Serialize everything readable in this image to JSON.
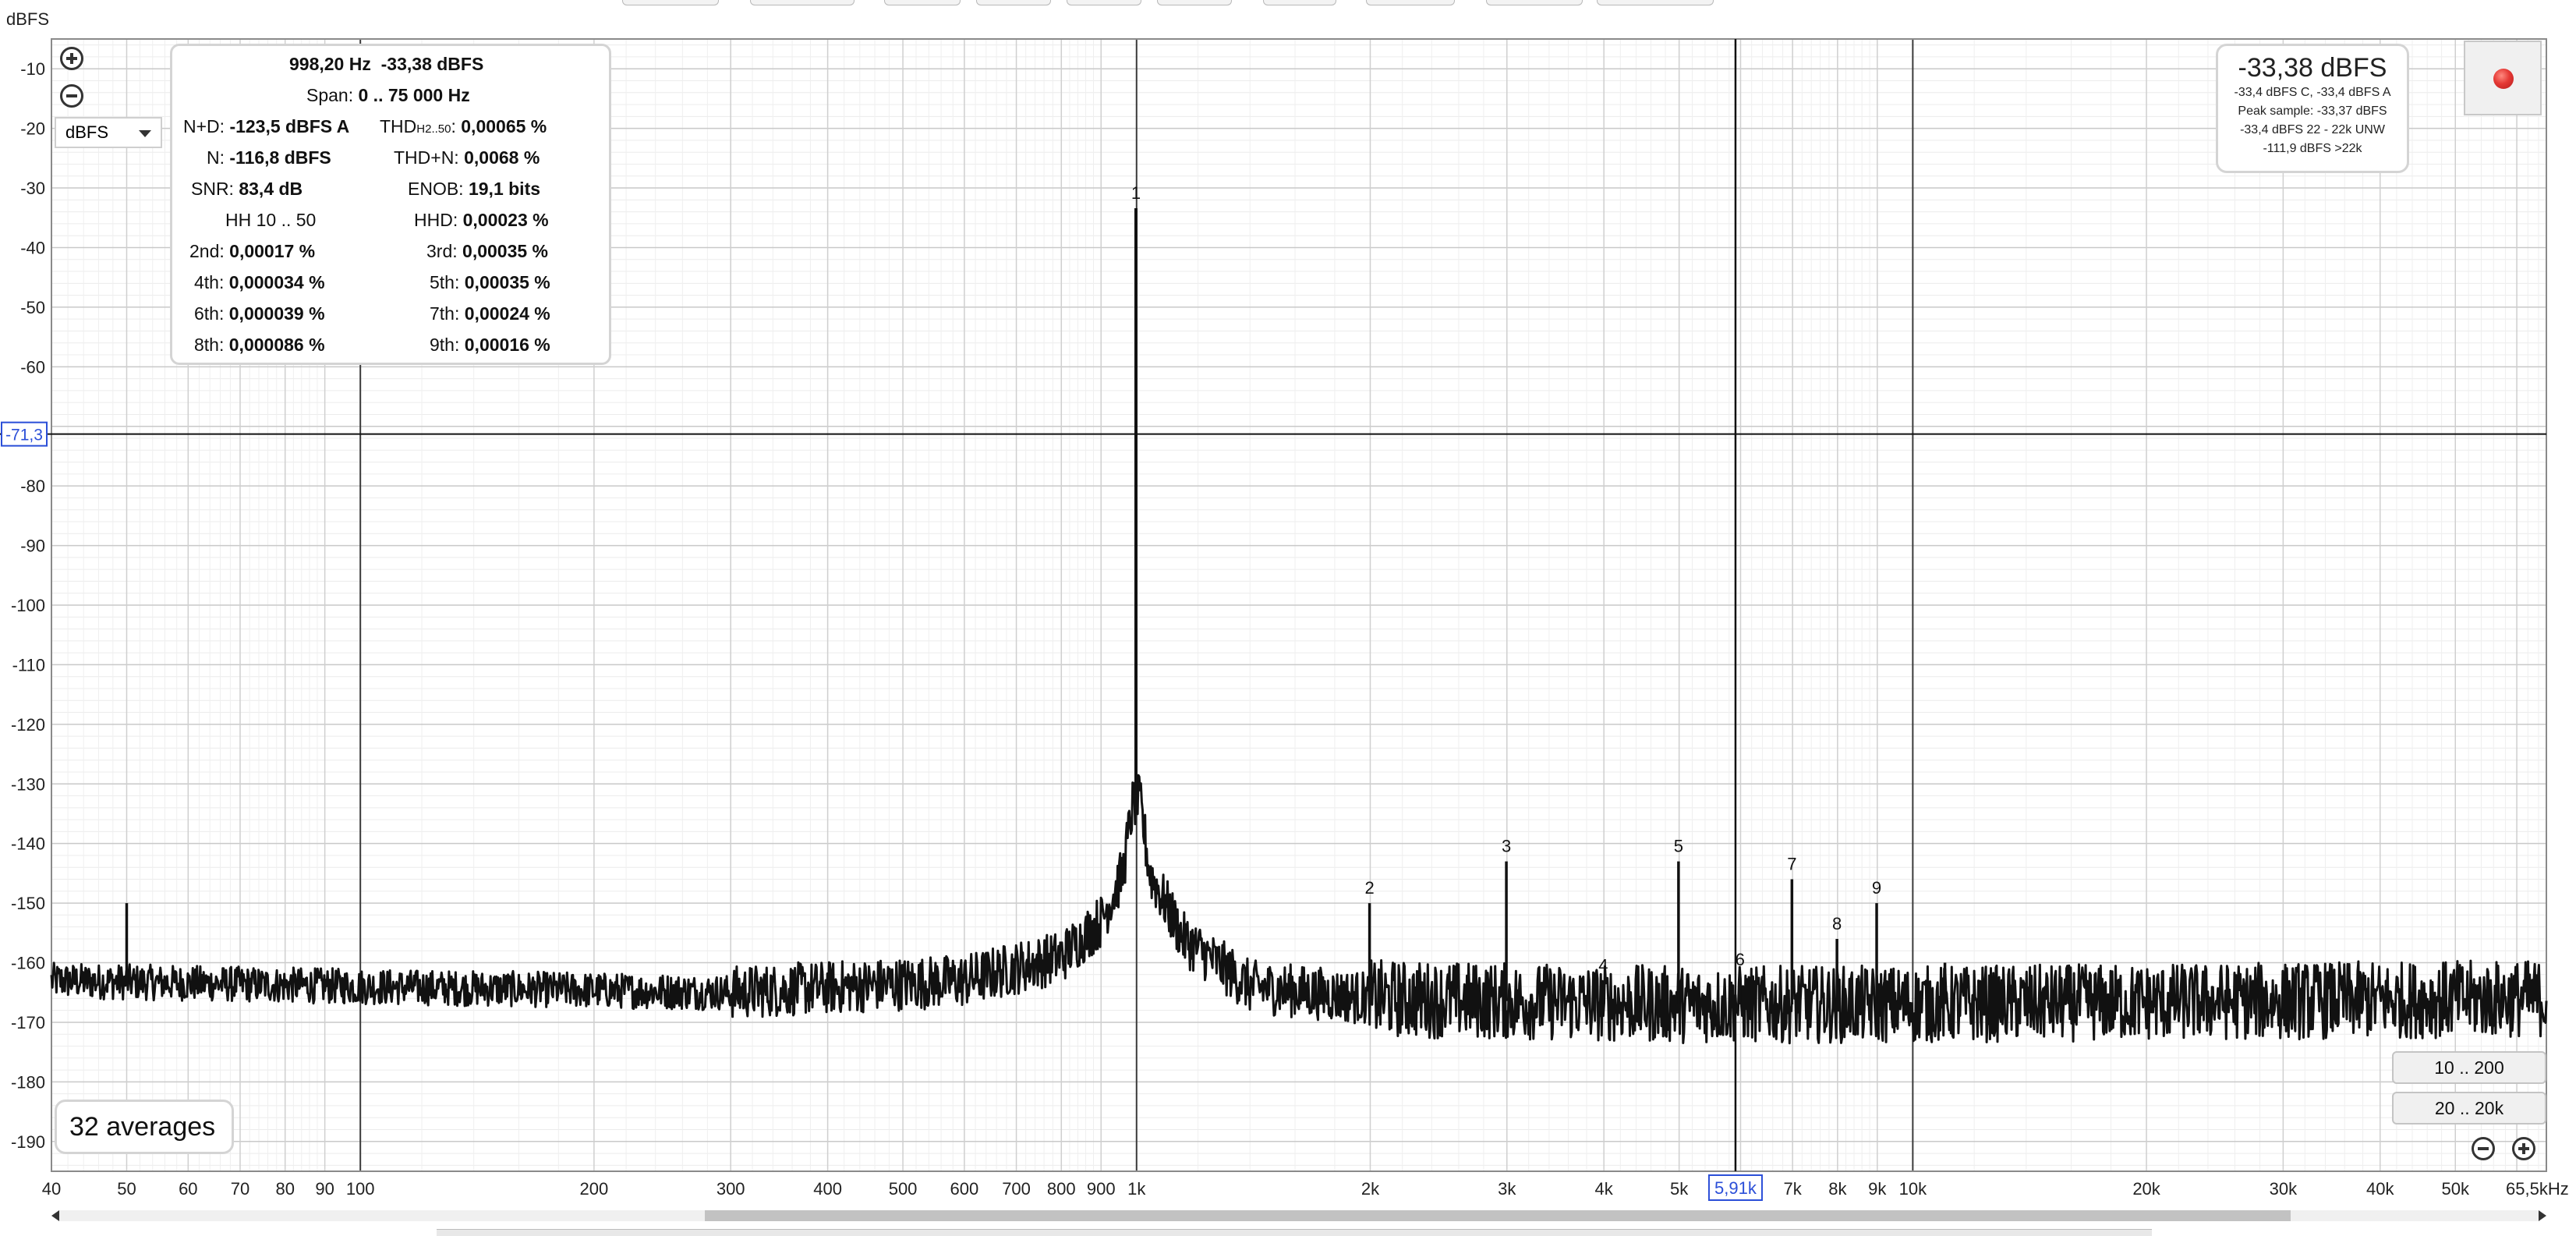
{
  "toolbar": {
    "tabs": 11
  },
  "axis": {
    "y_unit": "dBFS",
    "x_unit_suffix": "65,5kHz"
  },
  "unit_select": {
    "value": "dBFS"
  },
  "cursor": {
    "y_readout": "-71,3",
    "x_readout": "5,91k"
  },
  "info_panel": {
    "freq": "998,20 Hz",
    "level": "-33,38 dBFS",
    "span_label": "Span:",
    "span_value": "0 .. 75 000 Hz",
    "nd_label": "N+D:",
    "nd_value": "-123,5 dBFS A",
    "thd_label_main": "THD",
    "thd_label_sub": "H2..50",
    "thd_value": "0,00065 %",
    "n_label": "N:",
    "n_value": "-116,8 dBFS",
    "thdn_label": "THD+N:",
    "thdn_value": "0,0068 %",
    "snr_label": "SNR:",
    "snr_value": "83,4 dB",
    "enob_label": "ENOB:",
    "enob_value": "19,1 bits",
    "hh_label": "HH 10 .. 50",
    "hhd_label": "HHD:",
    "hhd_value": "0,00023 %",
    "h2_label": "2nd:",
    "h2_value": "0,00017 %",
    "h3_label": "3rd:",
    "h3_value": "0,00035 %",
    "h4_label": "4th:",
    "h4_value": "0,000034 %",
    "h5_label": "5th:",
    "h5_value": "0,00035 %",
    "h6_label": "6th:",
    "h6_value": "0,000039 %",
    "h7_label": "7th:",
    "h7_value": "0,00024 %",
    "h8_label": "8th:",
    "h8_value": "0,000086 %",
    "h9_label": "9th:",
    "h9_value": "0,00016 %"
  },
  "level_box": {
    "main": "-33,38 dBFS",
    "line1": "-33,4 dBFS C, -33,4 dBFS A",
    "line2": "Peak sample: -33,37 dBFS",
    "line3": "-33,4 dBFS 22 - 22k UNW",
    "line4": "-111,9 dBFS >22k"
  },
  "averages": "32 averages",
  "range_buttons": {
    "a": "10 .. 200",
    "b": "20 .. 20k"
  },
  "chart_data": {
    "type": "line",
    "xscale": "log",
    "xlim": [
      40,
      65500
    ],
    "ylim": [
      -195,
      -5
    ],
    "ylabel": "dBFS",
    "y_ticks": [
      -10,
      -20,
      -30,
      -40,
      -50,
      -60,
      -80,
      -90,
      -100,
      -110,
      -120,
      -130,
      -140,
      -150,
      -160,
      -170,
      -180,
      -190
    ],
    "y_tick_labels": [
      "-10",
      "-20",
      "-30",
      "-40",
      "-50",
      "-60",
      "-80",
      "-90",
      "-100",
      "-110",
      "-120",
      "-130",
      "-140",
      "-150",
      "-160",
      "-170",
      "-180",
      "-190"
    ],
    "x_ticks": [
      40,
      50,
      60,
      70,
      80,
      90,
      100,
      200,
      300,
      400,
      500,
      600,
      700,
      800,
      900,
      1000,
      2000,
      3000,
      4000,
      5000,
      7000,
      8000,
      9000,
      10000,
      20000,
      30000,
      40000,
      50000
    ],
    "x_tick_labels": [
      "40",
      "50",
      "60",
      "70",
      "80",
      "90",
      "100",
      "200",
      "300",
      "400",
      "500",
      "600",
      "700",
      "800",
      "900",
      "1k",
      "2k",
      "3k",
      "4k",
      "5k",
      "7k",
      "8k",
      "9k",
      "10k",
      "20k",
      "30k",
      "40k",
      "50k"
    ],
    "grid": true,
    "noise_floor": [
      [
        40,
        -163
      ],
      [
        100,
        -164
      ],
      [
        300,
        -165
      ],
      [
        600,
        -163
      ],
      [
        800,
        -159
      ],
      [
        900,
        -153
      ],
      [
        960,
        -145
      ],
      [
        990,
        -133
      ],
      [
        1010,
        -133
      ],
      [
        1040,
        -145
      ],
      [
        1150,
        -156
      ],
      [
        1400,
        -164
      ],
      [
        2000,
        -166
      ],
      [
        5000,
        -167
      ],
      [
        10000,
        -167
      ],
      [
        65500,
        -166
      ]
    ],
    "peaks": [
      {
        "label": "",
        "x": 50,
        "y": -150
      },
      {
        "label": "1",
        "x": 998.2,
        "y": -33.4
      },
      {
        "label": "2",
        "x": 1996,
        "y": -150
      },
      {
        "label": "3",
        "x": 2995,
        "y": -143
      },
      {
        "label": "4",
        "x": 3993,
        "y": -163
      },
      {
        "label": "5",
        "x": 4991,
        "y": -143
      },
      {
        "label": "6",
        "x": 5989,
        "y": -162
      },
      {
        "label": "7",
        "x": 6987,
        "y": -146
      },
      {
        "label": "8",
        "x": 7986,
        "y": -156
      },
      {
        "label": "9",
        "x": 8984,
        "y": -150
      },
      {
        "label": "",
        "x": 11000,
        "y": -160
      }
    ],
    "cursor": {
      "x": 5910,
      "y": -71.3
    }
  }
}
